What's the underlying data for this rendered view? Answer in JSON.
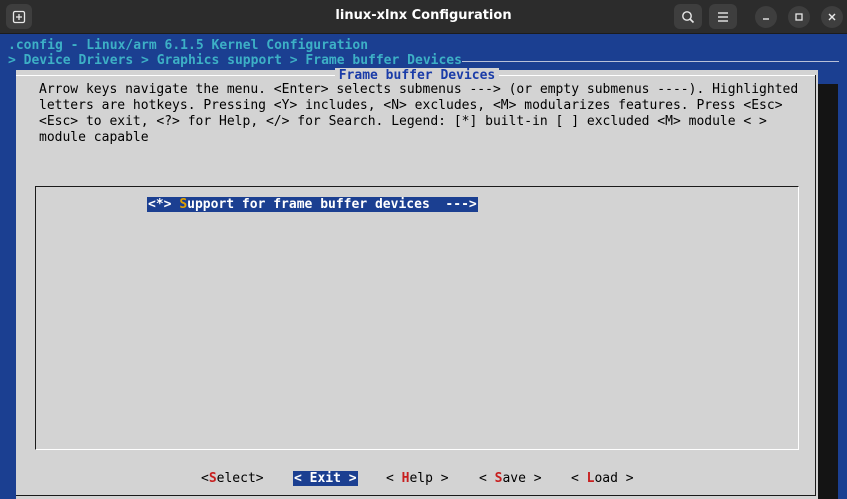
{
  "window": {
    "title": "linux-xlnx Configuration"
  },
  "titlebar_icons": {
    "new_tab": "new-tab-icon",
    "search": "search-icon",
    "menu": "hamburger-menu-icon",
    "minimize": "minimize-icon",
    "maximize": "maximize-icon",
    "close": "close-icon"
  },
  "terminal": {
    "config_line": ".config - Linux/arm 6.1.5 Kernel Configuration",
    "breadcrumb": "> Device Drivers > Graphics support > Frame buffer Devices"
  },
  "dialog": {
    "title": "Frame buffer Devices",
    "help_text": "Arrow keys navigate the menu.  <Enter> selects submenus ---> (or empty submenus ----).  Highlighted letters are hotkeys.  Pressing <Y> includes, <N> excludes, <M> modularizes features.  Press <Esc><Esc> to exit, <?> for Help, </> for Search.  Legend: [*] built-in  [ ] excluded  <M> module  < > module capable"
  },
  "menu": {
    "items": [
      {
        "prefix": "<*> ",
        "hotkey": "S",
        "rest": "upport for frame buffer devices  --->",
        "selected": true
      }
    ]
  },
  "buttons": {
    "select": {
      "pre": "<",
      "hk": "S",
      "post": "elect>"
    },
    "exit": {
      "pre": "< ",
      "hk": "E",
      "post": "xit >"
    },
    "help": {
      "pre": "< ",
      "hk": "H",
      "post": "elp >"
    },
    "save": {
      "pre": "< ",
      "hk": "S",
      "post": "ave >"
    },
    "load": {
      "pre": "< ",
      "hk": "L",
      "post": "oad >"
    }
  },
  "colors": {
    "terminal_bg": "#1b3f91",
    "dialog_bg": "#d3d3d3",
    "highlight_bg": "#1b3f91",
    "hotkey_selected": "#e0a000",
    "hotkey_button": "#c81e1e",
    "title_text": "#1a3ca8"
  }
}
